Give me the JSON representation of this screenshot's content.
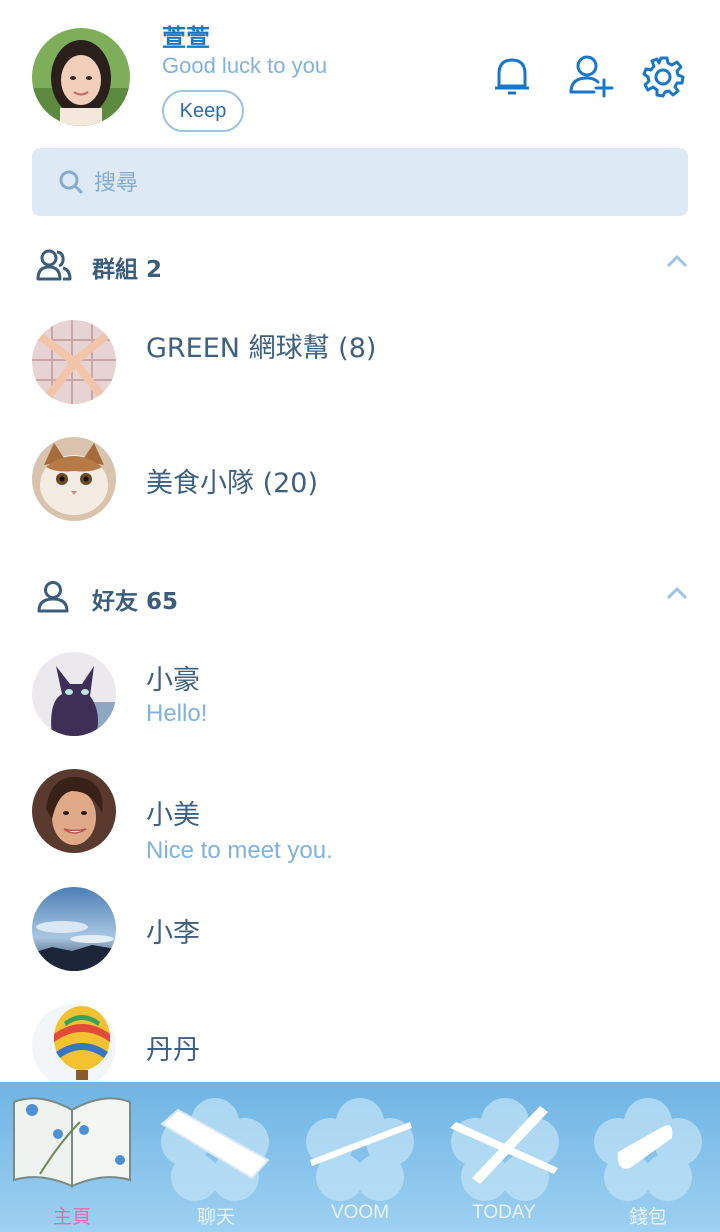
{
  "profile": {
    "name": "萱萱",
    "status": "Good luck to you",
    "keep_label": "Keep"
  },
  "icons": {
    "notifications": "bell-icon",
    "add_friend": "add-friend-icon",
    "settings": "gear-icon",
    "search": "search-icon"
  },
  "search": {
    "placeholder": "搜尋"
  },
  "groups": {
    "title": "群組 2",
    "items": [
      {
        "name": "GREEN 網球幫 (8)"
      },
      {
        "name": "美食小隊 (20)"
      }
    ]
  },
  "friends": {
    "title": "好友 65",
    "items": [
      {
        "name": "小豪",
        "status": "Hello!"
      },
      {
        "name": "小美",
        "status": "Nice to meet you."
      },
      {
        "name": "小李",
        "status": ""
      },
      {
        "name": "丹丹",
        "status": ""
      }
    ]
  },
  "tabs": [
    {
      "label": "主頁",
      "active": true
    },
    {
      "label": "聊天",
      "active": false
    },
    {
      "label": "VOOM",
      "active": false
    },
    {
      "label": "TODAY",
      "active": false
    },
    {
      "label": "錢包",
      "active": false
    }
  ],
  "colors": {
    "accent": "#1877c9",
    "status_text": "#7fb2de",
    "search_bg": "#dde9f4",
    "active_tab": "#e46fa6",
    "tabbar": "#6fb4e4"
  }
}
